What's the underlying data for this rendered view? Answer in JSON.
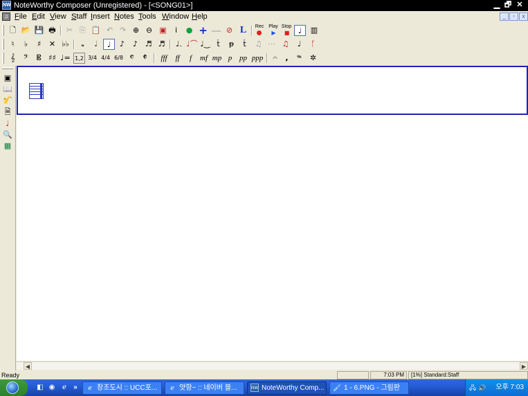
{
  "window": {
    "app_icon_text": "NW",
    "title": "NoteWorthy Composer (Unregistered) - [<SONG01>]",
    "minimize_glyph": "▁",
    "restore_glyph": "🗗",
    "close_glyph": "✕"
  },
  "menubar": {
    "items": [
      {
        "label": "File",
        "key": "F"
      },
      {
        "label": "Edit",
        "key": "E"
      },
      {
        "label": "View",
        "key": "V"
      },
      {
        "label": "Staff",
        "key": "S"
      },
      {
        "label": "Insert",
        "key": "I"
      },
      {
        "label": "Notes",
        "key": "N"
      },
      {
        "label": "Tools",
        "key": "T"
      },
      {
        "label": "Window",
        "key": "W"
      },
      {
        "label": "Help",
        "key": "H"
      }
    ],
    "mdi_minimize": "_",
    "mdi_restore": "▫",
    "mdi_close": "x"
  },
  "toolbar1": {
    "rec_label": "Rec",
    "play_label": "Play",
    "stop_label": "Stop",
    "rec_color": "#e02020",
    "play_color": "#2050e0",
    "stop_color": "#e02020",
    "icons": [
      "new-icon",
      "open-icon",
      "save-icon",
      "print-icon",
      "cut-icon",
      "copy-icon",
      "paste-icon",
      "undo-icon",
      "redo-icon",
      "zoom-in-icon",
      "zoom-out-icon",
      "transpose-icon",
      "info-icon",
      "globe-icon",
      "plus-icon",
      "minus-icon",
      "mute-icon",
      "layout-icon",
      "record-icon",
      "play-icon",
      "stop-icon",
      "staff-select-icon",
      "keyboard-icon"
    ]
  },
  "toolbar2": {
    "icons": [
      "natural-icon",
      "flat-icon",
      "sharp-icon",
      "double-sharp-icon",
      "double-flat-icon",
      "whole-note-icon",
      "half-note-icon",
      "quarter-note-icon",
      "eighth-note-icon",
      "sixteenth-note-icon",
      "thirtysecond-note-icon",
      "sixtyfourth-note-icon",
      "dotted-note-icon",
      "tie-icon",
      "slur-icon",
      "staccato-icon",
      "accent-icon",
      "tenuto-icon",
      "triplet-icon",
      "grace-icon",
      "beam-icon",
      "grace-note-icon",
      "stem-icon"
    ]
  },
  "toolbar3": {
    "dynamics": [
      "fff",
      "ff",
      "f",
      "mf",
      "mp",
      "p",
      "pp",
      "ppp"
    ],
    "icons": [
      "treble-clef-icon",
      "bass-clef-icon",
      "alto-clef-icon",
      "key-signature-icon",
      "tempo-icon",
      "ending-icon",
      "time-sig-34-icon",
      "time-sig-44-icon",
      "time-sig-68-icon",
      "common-time-icon",
      "cut-time-icon",
      "fermata-icon",
      "breath-mark-icon",
      "pedal-icon",
      "pedal-release-icon"
    ]
  },
  "left_toolbar": {
    "icons": [
      "staff-properties-icon",
      "book-icon",
      "instrument-icon",
      "page-setup-icon",
      "note-color-icon",
      "find-icon",
      "view-grid-icon"
    ]
  },
  "status": {
    "ready": "Ready",
    "time": "7:03 PM",
    "staff_info": "[1%] Standard:Staff"
  },
  "taskbar": {
    "tasks": [
      {
        "label": "창조도시 :: UCC포...",
        "icon": "ie-icon",
        "active": false
      },
      {
        "label": "얏항~ :: 네이버 블...",
        "icon": "ie-icon",
        "active": false
      },
      {
        "label": "NoteWorthy Comp...",
        "icon": "noteworthy-icon",
        "active": true
      },
      {
        "label": "1 - 6.PNG - 그림판",
        "icon": "paint-icon",
        "active": false
      }
    ],
    "clock": "오후 7:03",
    "chevron": "»"
  }
}
